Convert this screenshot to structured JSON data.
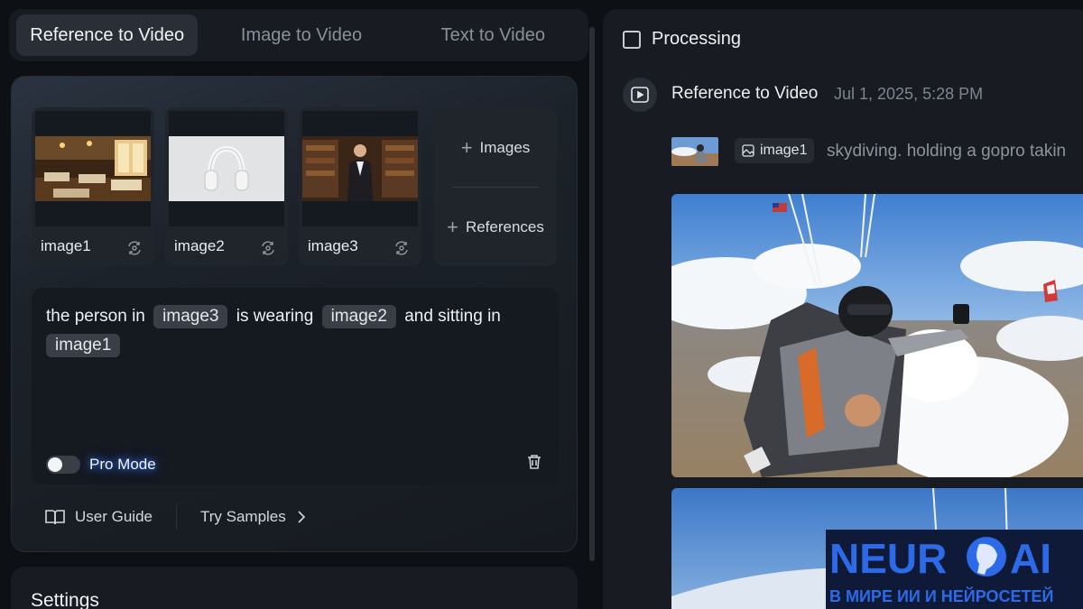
{
  "tabs": [
    {
      "label": "Reference to Video",
      "active": true
    },
    {
      "label": "Image to Video",
      "active": false
    },
    {
      "label": "Text to Video",
      "active": false
    }
  ],
  "references": [
    {
      "label": "image1",
      "icon": "swap-icon"
    },
    {
      "label": "image2",
      "icon": "swap-icon"
    },
    {
      "label": "image3",
      "icon": "swap-icon"
    }
  ],
  "add": {
    "images_label": "Images",
    "references_label": "References"
  },
  "prompt": {
    "part1": "the person in",
    "chip1": "image3",
    "part2": "is wearing",
    "chip2": "image2",
    "part3": "and sitting in",
    "chip3": "image1"
  },
  "pro_mode": {
    "label": "Pro Mode",
    "enabled": false
  },
  "footer": {
    "user_guide": "User Guide",
    "try_samples": "Try Samples"
  },
  "settings": {
    "title": "Settings"
  },
  "results": {
    "processing_label": "Processing",
    "processing_checked": false,
    "task": {
      "title": "Reference to Video",
      "date": "Jul 1, 2025, 5:28 PM",
      "ref_chip": "image1",
      "prompt": "skydiving. holding a gopro takin"
    }
  },
  "watermark": {
    "title_left": "NEUR",
    "title_right": "AI",
    "subtitle": "В МИРЕ ИИ И НЕЙРОСЕТЕЙ"
  },
  "colors": {
    "background": "#0d1116",
    "panel": "#181c22",
    "chip": "#3a3f47",
    "pro_glow": "#3a7bff",
    "watermark_blue": "#1e5bd8"
  }
}
